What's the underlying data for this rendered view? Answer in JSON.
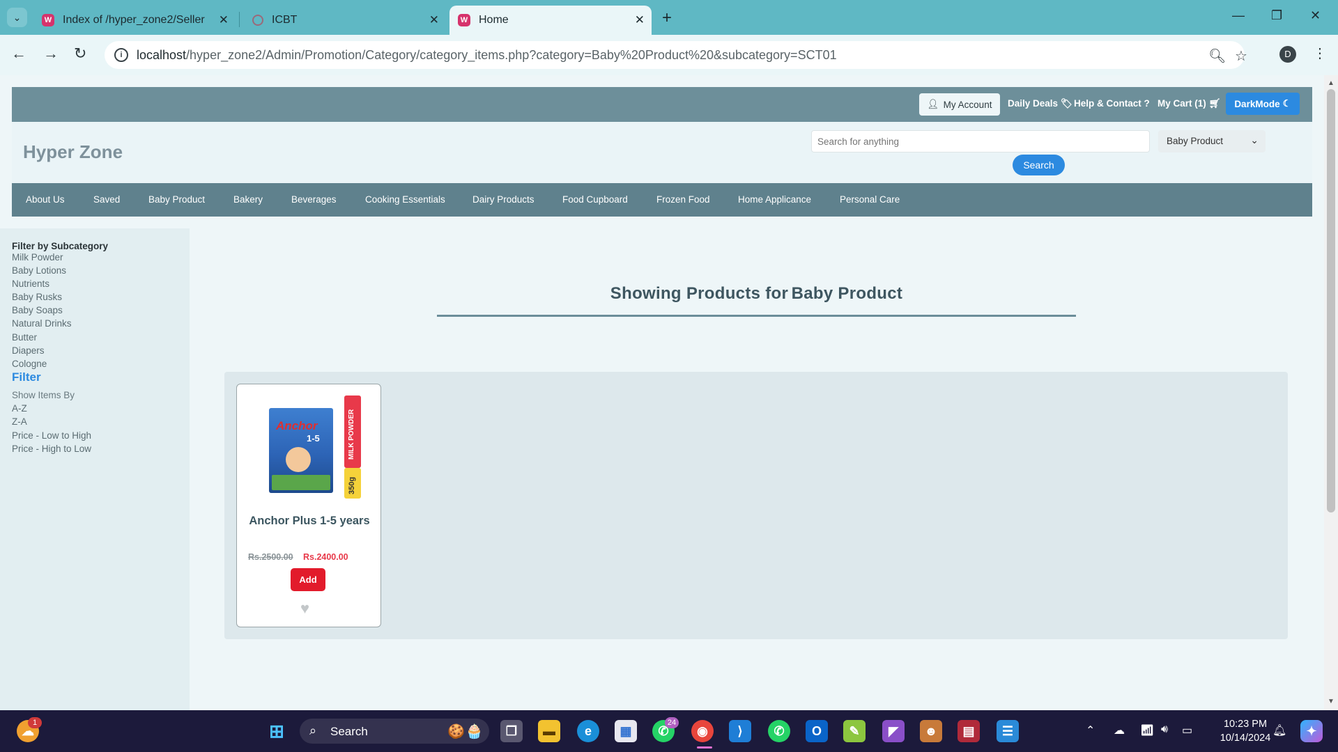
{
  "browser": {
    "tabs": [
      {
        "title": "Index of /hyper_zone2/Seller"
      },
      {
        "title": "ICBT"
      },
      {
        "title": "Home"
      }
    ],
    "url_host": "localhost",
    "url_path": "/hyper_zone2/Admin/Promotion/Category/category_items.php?category=Baby%20Product%20&subcategory=SCT01",
    "profile_initial": "D"
  },
  "site": {
    "top_links": {
      "my_account": "My Account",
      "daily_deals": "Daily Deals",
      "help_contact": "Help & Contact",
      "my_cart": "My Cart (1)",
      "dark_mode": "DarkMode"
    },
    "brand": "Hyper Zone",
    "search": {
      "placeholder": "Search for anything",
      "category_selected": "Baby Product",
      "button": "Search"
    },
    "categories": [
      "About Us",
      "Saved",
      "Baby Product",
      "Bakery",
      "Beverages",
      "Cooking Essentials",
      "Dairy Products",
      "Food Cupboard",
      "Frozen Food",
      "Home Applicance",
      "Personal Care"
    ]
  },
  "sidebar": {
    "title": "Filter by Subcategory",
    "subcategories": [
      "Milk Powder",
      "Baby Lotions",
      "Nutrients",
      "Baby Rusks",
      "Baby Soaps",
      "Natural Drinks",
      "Butter",
      "Diapers",
      "Cologne"
    ],
    "filter_label": "Filter",
    "show_by_label": "Show Items By",
    "sort_options": [
      "A-Z",
      "Z-A",
      "Price - Low to High",
      "Price - High to Low"
    ]
  },
  "main": {
    "heading_prefix": "Showing Products for",
    "heading_category": "Baby Product"
  },
  "products": [
    {
      "pack_brand": "Anchor",
      "pack_age": "1-5",
      "ribbon": "MILK POWDER",
      "weight": "350g",
      "name": "Anchor Plus 1-5 years",
      "old_price": "Rs.2500.00",
      "new_price": "Rs.2400.00",
      "add_label": "Add"
    }
  ],
  "taskbar": {
    "search_label": "Search",
    "whatsapp_badge": "24",
    "weather_badge": "1",
    "time": "10:23 PM",
    "date": "10/14/2024"
  },
  "colors": {
    "accent": "#2c8ae0",
    "nav_bg": "#5f818d",
    "topbar_bg": "#6d8f9a",
    "add_button": "#e21b2b",
    "tab_strip": "#5fb8c4"
  }
}
